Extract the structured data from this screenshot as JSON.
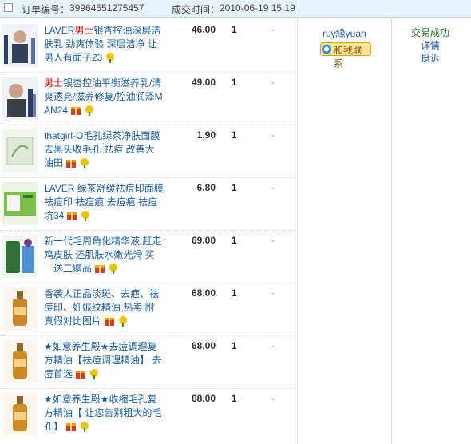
{
  "header": {
    "order_label": "订单编号：",
    "order_no": "39964551275457",
    "time_label": "成交时间：",
    "time": "2010-06-19 15:19"
  },
  "items": [
    {
      "title_pre": "LAVER",
      "title_red": "男士",
      "title_rest": "银杏控油深层洁肤乳 劲爽体验 深层洁净 让男人有面子23",
      "price": "46.00",
      "qty": "1",
      "dash": "-"
    },
    {
      "title_pre": "",
      "title_red": "男士",
      "title_rest": "银杏控油平衡滋养乳/清爽透亮/滋养修复/控油润泽MAN24",
      "price": "49.00",
      "qty": "1",
      "dash": "-"
    },
    {
      "title_pre": "thatgirl-O毛孔绿茶净肤面膜 去黑头收毛孔 祛痘 改善大油田",
      "title_red": "",
      "title_rest": "",
      "price": "1.90",
      "qty": "1",
      "dash": "-"
    },
    {
      "title_pre": "LAVER 绿茶舒缓祛痘印面膜 祛痘印 祛痘痕 去痘疤 祛痘坑34",
      "title_red": "",
      "title_rest": "",
      "price": "6.80",
      "qty": "1",
      "dash": "-"
    },
    {
      "title_pre": "新一代毛周角化精华液 赶走鸡皮肤 还肌肤水嫩光滑 买一送二赠品",
      "title_red": "",
      "title_rest": "",
      "price": "69.00",
      "qty": "1",
      "dash": "-"
    },
    {
      "title_pre": "香袭人正品淡斑、去疤、祛痘印、妊娠纹精油 热卖 附真假对比图片",
      "title_red": "",
      "title_rest": "",
      "price": "68.00",
      "qty": "1",
      "dash": "-"
    },
    {
      "title_pre": "★如意养生殿★去痘调理复方精油【祛痘调理精油】 去痘首选",
      "title_red": "",
      "title_rest": "",
      "price": "68.00",
      "qty": "1",
      "dash": "-"
    },
    {
      "title_pre": "★如意养生殿★收缩毛孔复方精油【 让您告别粗大的毛孔】",
      "title_red": "",
      "title_rest": "",
      "price": "68.00",
      "qty": "1",
      "dash": "-"
    }
  ],
  "seller": {
    "name": "ruy緣yuan",
    "contact_label": "和我联系"
  },
  "status": {
    "state": "交易成功",
    "details": "详情",
    "complaint": "投诉"
  },
  "colors": {
    "link": "#1a5ea8",
    "accent_red": "#d40000",
    "success": "#1f7a1f",
    "header_bg": "#e8f2fd"
  }
}
